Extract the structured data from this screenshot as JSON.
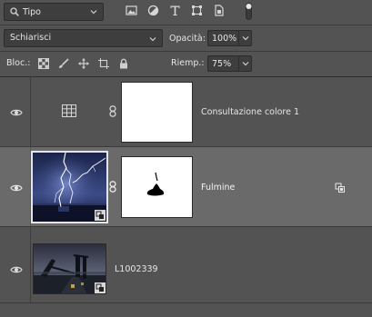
{
  "filter": {
    "kind_label": "Tipo"
  },
  "blend": {
    "mode": "Schiarisci"
  },
  "opacity": {
    "label": "Opacità:",
    "value": "100%"
  },
  "lock": {
    "label": "Bloc.:"
  },
  "fill": {
    "label": "Riemp.:",
    "value": "75%"
  },
  "layers": [
    {
      "name": "Consultazione colore 1",
      "selected": false
    },
    {
      "name": "Fulmine",
      "selected": true
    },
    {
      "name": "L1002339",
      "selected": false
    }
  ],
  "colors": {
    "panel": "#535353",
    "selected_row": "#6a6a6a",
    "field": "#3e3e3e"
  },
  "icons": [
    "search-icon",
    "image-filter-icon",
    "adjustment-filter-icon",
    "type-filter-icon",
    "shape-filter-icon",
    "smart-object-filter-icon",
    "filter-toggle-icon",
    "lock-pixels-icon",
    "lock-brush-icon",
    "lock-position-icon",
    "lock-artboard-icon",
    "lock-all-icon",
    "eye-icon",
    "chain-icon",
    "color-lookup-icon",
    "smart-object-badge-icon",
    "layer-options-icon"
  ]
}
